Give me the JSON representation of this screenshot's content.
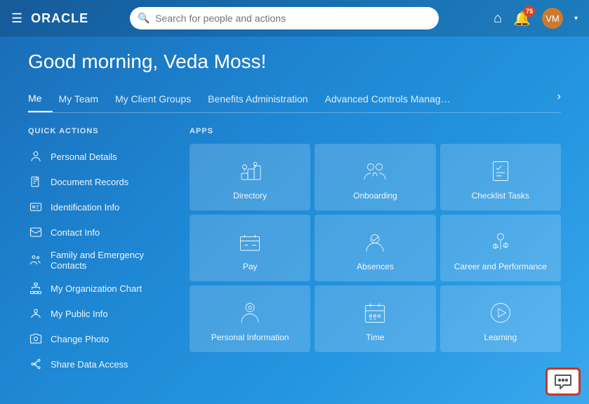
{
  "header": {
    "logo": "ORACLE",
    "search_placeholder": "Search for people and actions",
    "notification_count": "75",
    "home_icon": "home",
    "notification_icon": "bell",
    "user_avatar_initials": "VM"
  },
  "greeting": "Good morning, Veda Moss!",
  "tabs": {
    "items": [
      {
        "label": "Me",
        "active": true
      },
      {
        "label": "My Team",
        "active": false
      },
      {
        "label": "My Client Groups",
        "active": false
      },
      {
        "label": "Benefits Administration",
        "active": false
      },
      {
        "label": "Advanced Controls Manag…",
        "active": false
      }
    ],
    "more_arrow": "›"
  },
  "quick_actions": {
    "section_label": "QUICK ACTIONS",
    "items": [
      {
        "label": "Personal Details",
        "icon": "person"
      },
      {
        "label": "Document Records",
        "icon": "document"
      },
      {
        "label": "Identification Info",
        "icon": "id"
      },
      {
        "label": "Contact Info",
        "icon": "envelope"
      },
      {
        "label": "Family and Emergency Contacts",
        "icon": "family"
      },
      {
        "label": "My Organization Chart",
        "icon": "org"
      },
      {
        "label": "My Public Info",
        "icon": "public"
      },
      {
        "label": "Change Photo",
        "icon": "camera"
      },
      {
        "label": "Share Data Access",
        "icon": "share"
      }
    ]
  },
  "apps": {
    "section_label": "APPS",
    "items": [
      {
        "label": "Directory",
        "icon": "directory"
      },
      {
        "label": "Onboarding",
        "icon": "onboarding"
      },
      {
        "label": "Checklist Tasks",
        "icon": "checklist"
      },
      {
        "label": "Pay",
        "icon": "pay"
      },
      {
        "label": "Absences",
        "icon": "absences"
      },
      {
        "label": "Career and Performance",
        "icon": "career"
      },
      {
        "label": "Personal Information",
        "icon": "personal-info"
      },
      {
        "label": "Time",
        "icon": "time"
      },
      {
        "label": "Learning",
        "icon": "learning"
      }
    ]
  },
  "chat": {
    "icon": "chat-bubble"
  }
}
